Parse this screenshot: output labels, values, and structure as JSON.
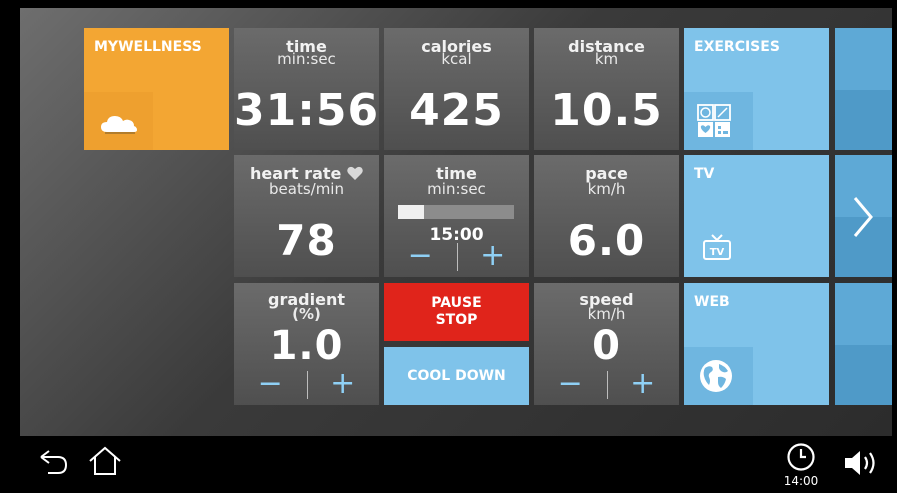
{
  "tiles": {
    "mywellness": {
      "label": "MYWELLNESS",
      "icon": "cloud-icon"
    },
    "time": {
      "label": "time",
      "unit": "min:sec",
      "value": "31:56"
    },
    "calories": {
      "label": "calories",
      "unit": "kcal",
      "value": "425"
    },
    "distance": {
      "label": "distance",
      "unit": "km",
      "value": "10.5"
    },
    "exercises": {
      "label": "EXERCISES",
      "icon": "exercises-icon"
    },
    "heart_rate": {
      "label": "heart rate",
      "unit": "beats/min",
      "value": "78",
      "icon": "heart-icon"
    },
    "time_target": {
      "label": "time",
      "unit": "min:sec",
      "value": "15:00",
      "progress": 0.22,
      "minus": "−",
      "plus": "+"
    },
    "pace": {
      "label": "pace",
      "unit": "km/h",
      "value": "6.0"
    },
    "tv": {
      "label": "TV",
      "icon": "tv-icon",
      "icon_text": "TV"
    },
    "gradient": {
      "label": "gradient",
      "unit": "(%)",
      "value": "1.0",
      "minus": "−",
      "plus": "+"
    },
    "pause_stop": {
      "line1": "PAUSE",
      "line2": "STOP"
    },
    "cool_down": {
      "label": "COOL DOWN"
    },
    "speed": {
      "label": "speed",
      "unit": "km/h",
      "value": "0",
      "minus": "−",
      "plus": "+"
    },
    "web": {
      "label": "WEB",
      "icon": "globe-icon"
    }
  },
  "nav": {
    "next_icon": "chevron-right-icon"
  },
  "bottom_bar": {
    "back_icon": "back-icon",
    "home_icon": "home-icon",
    "clock_icon": "clock-icon",
    "clock_time": "14:00",
    "volume_icon": "volume-icon"
  },
  "colors": {
    "orange": "#f3a633",
    "blue": "#7fc3ea",
    "red": "#e0241b",
    "gray": "#5a5a5a"
  }
}
